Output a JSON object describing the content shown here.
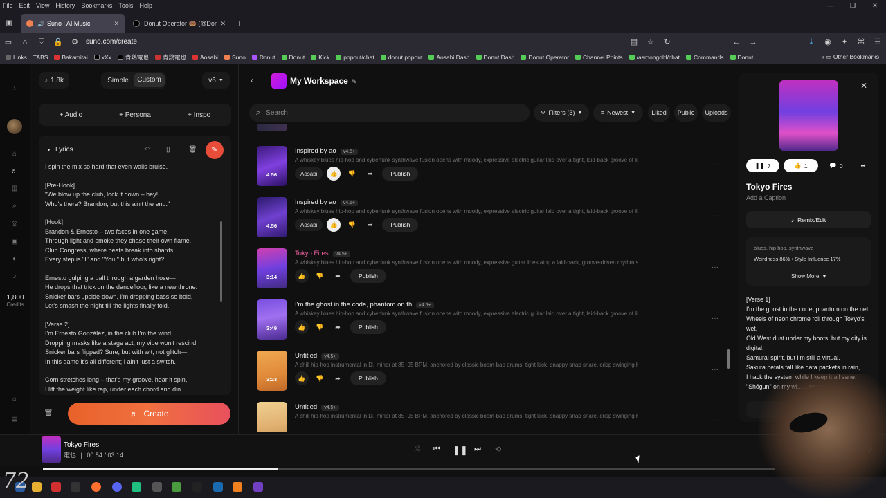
{
  "browser": {
    "menu": [
      "File",
      "Edit",
      "View",
      "History",
      "Bookmarks",
      "Tools",
      "Help"
    ],
    "tabs": [
      {
        "label": "Suno | AI Music",
        "active": true
      },
      {
        "label": "Donut Operator 🍩 (@DonutO",
        "active": false
      }
    ],
    "url": "suno.com/create",
    "bookmarks": [
      "Links",
      "TABS",
      "Bakamitai",
      "xXx",
      "青鶏電也",
      "青鶏電也",
      "Aosabi",
      "Suno",
      "Donut",
      "Donut",
      "Kick",
      "popout/chat",
      "donut popout",
      "Aosabi Dash",
      "Donut Dash",
      "Donut Operator",
      "Channel Points",
      "/asmongold/chat",
      "Commands",
      "Donut"
    ],
    "other_bookmarks": "Other Bookmarks",
    "colors": {
      "chrome": "#1c1b22",
      "toolbar": "#2b2a33"
    }
  },
  "sidebar": {
    "credits_value": "1,800",
    "credits_label": "Credits"
  },
  "create_panel": {
    "song_count": "1.8k",
    "mode_simple": "Simple",
    "mode_custom": "Custom",
    "model": "v6",
    "add_audio": "Audio",
    "add_persona": "Persona",
    "add_inspo": "Inspo",
    "lyrics_label": "Lyrics",
    "lyrics": "I spin the mix so hard that even walls bruise.\n\n[Pre-Hook]\n\"We blow up the club, lock it down – hey!\nWho's there? Brandon, but this ain't the end.\"\n\n[Hook]\nBrandon & Ernesto – two faces in one game,\nThrough light and smoke they chase their own flame.\nClub Congress, where beats break into shards,\nEvery step is \"I\" and \"You,\" but who's right?\n\nErnesto gulping a ball through a garden hose—\nHe drops that trick on the dancefloor, like a new throne.\nSnicker bars upside-down, I'm dropping bass so bold,\nLet's smash the night till the lights finally fold.\n\n[Verse 2]\nI'm Ernesto González, in the club I'm the wind,\nDropping masks like a stage act, my vibe won't rescind.\nSnicker bars flipped? Sure, but with wit, not glitch—\nIn this game it's all different; I ain't just a switch.\n\nCorn stretches long – that's my groove, hear it spin,\nI lift the weight like rap, under each chord and din.",
    "create_label": "Create",
    "create_gradient": [
      "#e8612a",
      "#e8505c"
    ]
  },
  "workspace": {
    "title": "My Workspace",
    "search_placeholder": "Search",
    "filters": "Filters (3)",
    "sort": "Newest",
    "liked": "Liked",
    "public": "Public",
    "uploads": "Uploads",
    "songs": [
      {
        "title": "Inspired by ao",
        "version": "v4.5+",
        "desc": "A whiskey blues hip-hop and cyberfunk synthwave fusion opens with moody, expressive electric guitar laid over a tight, laid-back groove of live b...",
        "duration": "4:56",
        "artist": "Aosabi",
        "liked": true,
        "pink": false
      },
      {
        "title": "Inspired by ao",
        "version": "v4.5+",
        "desc": "A whiskey blues hip-hop and cyberfunk synthwave fusion opens with moody, expressive electric guitar laid over a tight, laid-back groove of live b...",
        "duration": "4:56",
        "artist": "Aosabi",
        "liked": true,
        "pink": false
      },
      {
        "title": "Tokyo Fires",
        "version": "v4.5+",
        "desc": "A whiskey blues hip-hop and cyberfunk synthwave fusion opens with moody, expressive guitar lines atop a laid-back, groove-driven rhythm secti...",
        "duration": "3:14",
        "artist": "",
        "liked": false,
        "pink": true
      },
      {
        "title": "I'm the ghost in the code, phantom on th",
        "version": "v4.5+",
        "desc": "A whiskey blues hip-hop and cyberfunk synthwave fusion opens with moody, expressive electric guitar laid over a tight, laid-back groove of live b...",
        "duration": "3:49",
        "artist": "",
        "liked": false,
        "pink": false
      },
      {
        "title": "Untitled",
        "version": "v4.5+",
        "desc": "A chill hip-hop instrumental in D♭ minor at 85–95 BPM, anchored by classic boom-bap drums: tight kick, snappy snap snare, crisp swinging hats...",
        "duration": "3:23",
        "artist": "",
        "liked": false,
        "pink": false
      },
      {
        "title": "Untitled",
        "version": "v4.5+",
        "desc": "A chill hip-hop instrumental in D♭ minor at 85–95 BPM, anchored by classic boom-bap drums: tight kick, snappy snap snare, crisp swinging hats...",
        "duration": "",
        "artist": "",
        "liked": false,
        "pink": false
      }
    ],
    "publish_label": "Publish"
  },
  "detail": {
    "play_count": "7",
    "like_count": "1",
    "comment_count": "0",
    "title": "Tokyo Fires",
    "caption": "Add a Caption",
    "remix": "Remix/Edit",
    "tags": "blues, hip hop, synthwave",
    "weirdness": "Weirdness 86% • Style Influence 17%",
    "show_more": "Show More",
    "lyrics": "[Verse 1]\nI'm the ghost in the code, phantom on the net,\nWheels of neon chrome roll through Tokyo's wet.\nOld West dust under my boots, but my city is digital,\nSamurai spirit, but I'm still a virtual.\nSakura petals fall like data packets in rain,\nI hack the system while I keep it all sane.\n\"Shōgun\" on my wi... ...my hand,"
  },
  "player": {
    "title": "Tokyo Fires",
    "artist": "電也",
    "elapsed": "00:54",
    "total": "03:14",
    "progress_fraction": 0.32
  },
  "overlay": {
    "logo_text": "72"
  }
}
